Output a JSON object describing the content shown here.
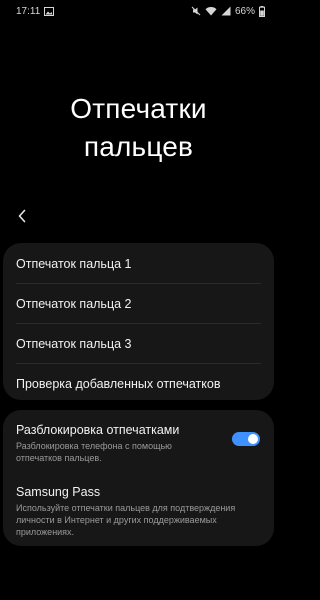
{
  "status_bar": {
    "time": "17:11",
    "battery": "66%",
    "icons": [
      "gallery-icon",
      "mute-icon",
      "wifi-icon",
      "signal-icon",
      "battery-icon"
    ]
  },
  "page": {
    "title_line1": "Отпечатки",
    "title_line2": "пальцев"
  },
  "fingerprints": [
    {
      "label": "Отпечаток пальца 1"
    },
    {
      "label": "Отпечаток пальца 2"
    },
    {
      "label": "Отпечаток пальца 3"
    },
    {
      "label": "Проверка добавленных отпечатков"
    }
  ],
  "settings": {
    "unlock": {
      "title": "Разблокировка отпечатками",
      "description": "Разблокировка телефона с помощью отпечатков пальцев.",
      "enabled": true
    },
    "samsung_pass": {
      "title": "Samsung Pass",
      "description": "Используйте отпечатки пальцев для подтверждения личности в Интернет и других поддерживаемых приложениях."
    }
  },
  "colors": {
    "background": "#000000",
    "card": "#171717",
    "accent": "#3e91ff"
  }
}
